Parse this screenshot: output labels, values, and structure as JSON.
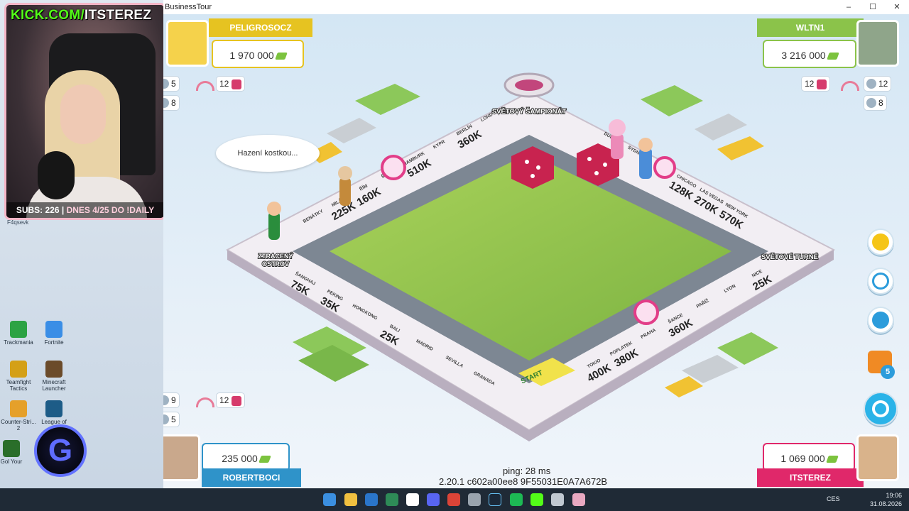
{
  "window": {
    "title": "BusinessTour",
    "minimize": "–",
    "maximize": "☐",
    "close": "✕"
  },
  "webcam": {
    "kick_prefix": "KICK.COM/",
    "kick_handle": "ITSTEREZ",
    "subs_text": "SUBS: 226",
    "daily_text": "DNES 4/25 DO !DAILY"
  },
  "desktop_icons": [
    {
      "label": "Trackmania",
      "color": "#2ca344"
    },
    {
      "label": "Fortnite",
      "color": "#3a8ee6"
    },
    {
      "label": "Teamfight Tactics",
      "color": "#d4a017"
    },
    {
      "label": "Minecraft Launcher",
      "color": "#6b4b2a"
    },
    {
      "label": "Counter-Stri... 2",
      "color": "#e5a02a"
    },
    {
      "label": "League of",
      "color": "#1d5c87"
    },
    {
      "label": "Gol Your",
      "color": "#2a6e2a"
    }
  ],
  "desktop_tag": "F4qsevk",
  "players": {
    "top_left": {
      "name": "PELIGROSOCZ",
      "money": "1 970 000",
      "color": "#e6c321",
      "stat_a": "5",
      "stat_b": "12",
      "stat_c": "8"
    },
    "top_right": {
      "name": "WLTN1",
      "money": "3 216 000",
      "color": "#8bc34a",
      "stat_a": "12",
      "stat_b": "12",
      "stat_c": "8"
    },
    "bottom_left": {
      "name": "ROBERTBOCI",
      "money": "235 000",
      "color": "#2f93c9",
      "stat_a": "9",
      "stat_b": "12",
      "stat_c": "5"
    },
    "bottom_right": {
      "name": "ITSTEREZ",
      "money": "1 069 000",
      "color": "#e0286a"
    }
  },
  "bubble": "Hazení kostkou...",
  "board": {
    "corners": {
      "top": "SVĚTOVÝ ŠAMPIONÁT",
      "left": "ZTRACENÝ OSTROV",
      "right": "SVĚTOVÉ TURNÉ",
      "bottom": "START"
    },
    "top_left_edge": [
      {
        "name": "BENÁTKY",
        "price": ""
      },
      {
        "name": "MILÁN",
        "price": "225K"
      },
      {
        "name": "ŘÍM",
        "price": "160K"
      },
      {
        "name": "ŠANCE",
        "price": ""
      },
      {
        "name": "HAMBURK",
        "price": "510K"
      },
      {
        "name": "KYPR",
        "price": ""
      },
      {
        "name": "BERLÍN",
        "price": "360K"
      },
      {
        "name": "LONDÝN",
        "price": ""
      }
    ],
    "top_right_edge": [
      {
        "name": "DUBAJ",
        "price": ""
      },
      {
        "name": "SYDNEY",
        "price": ""
      },
      {
        "name": "ŠANCE",
        "price": ""
      },
      {
        "name": "CHICAGO",
        "price": "128K"
      },
      {
        "name": "LAS VEGAS",
        "price": "270K"
      },
      {
        "name": "NEW YORK",
        "price": "570K"
      }
    ],
    "bottom_left_edge": [
      {
        "name": "ŠANGHAJ",
        "price": "75K"
      },
      {
        "name": "PEKING",
        "price": "35K"
      },
      {
        "name": "HONGKONG",
        "price": ""
      },
      {
        "name": "BALI",
        "price": "25K"
      },
      {
        "name": "MADRID",
        "price": ""
      },
      {
        "name": "SEVILLA",
        "price": ""
      },
      {
        "name": "GRANADA",
        "price": ""
      }
    ],
    "bottom_right_edge": [
      {
        "name": "TOKIO",
        "price": "400K"
      },
      {
        "name": "POPLATEK",
        "price": "380K"
      },
      {
        "name": "PRAHA",
        "price": ""
      },
      {
        "name": "ŠANCE",
        "price": "360K"
      },
      {
        "name": "PAŘÍŽ",
        "price": ""
      },
      {
        "name": "LYON",
        "price": ""
      },
      {
        "name": "NICE",
        "price": "25K"
      }
    ]
  },
  "side_buttons": {
    "chest_count": "5"
  },
  "footer": {
    "ping": "ping: 28 ms",
    "version": "2.20.1 c602a00ee8 9F55031E0A7A672B"
  },
  "taskbar": {
    "lang": "CES",
    "time": "19:06",
    "date": "31.08.2026"
  }
}
